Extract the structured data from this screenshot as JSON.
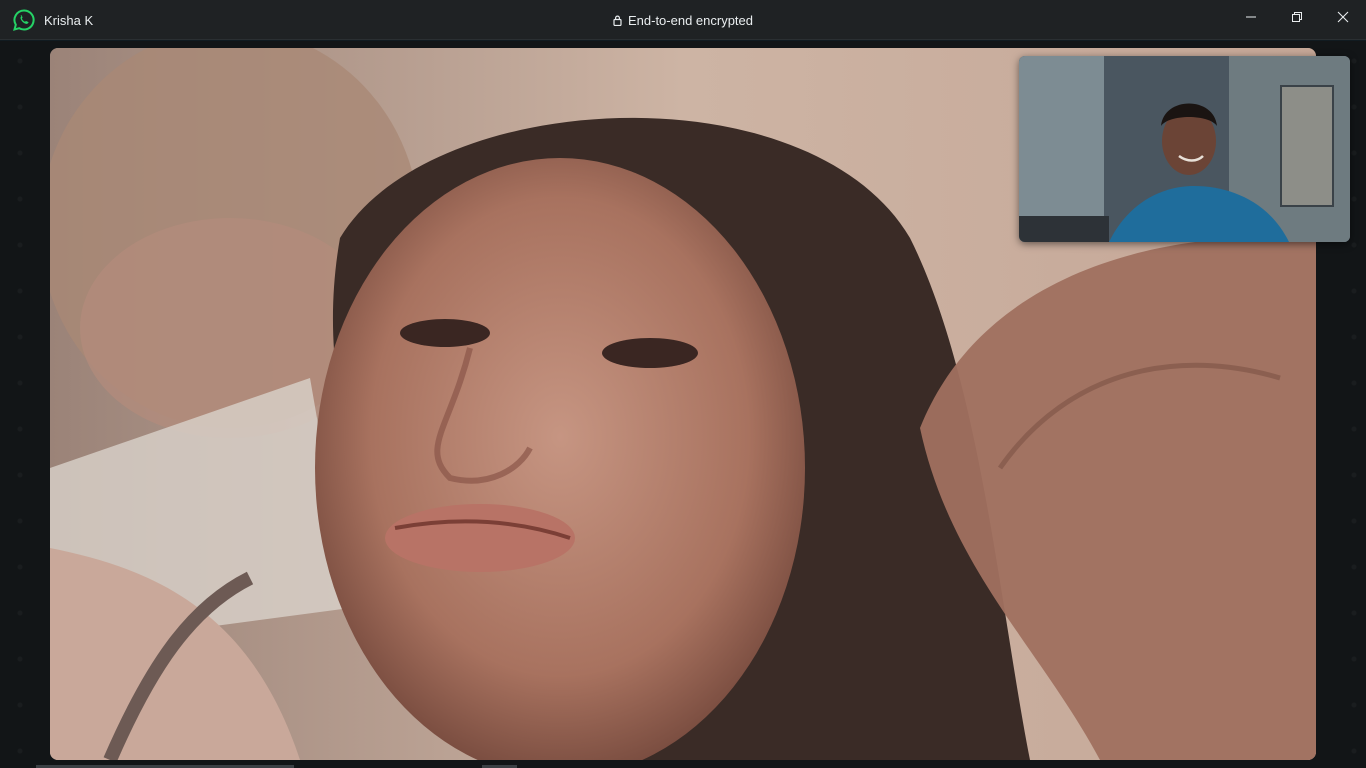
{
  "window": {
    "contact_name": "Krisha K",
    "encryption_status": "End-to-end encrypted",
    "app_icon": "whatsapp-icon",
    "controls": [
      "minimize-icon",
      "restore-icon",
      "close-icon"
    ]
  },
  "call": {
    "remote_video": "remote-participant-video",
    "self_video": "self-preview-video"
  },
  "colors": {
    "titlebar": "#1f2224",
    "accent_green": "#25d366",
    "background": "#121517"
  }
}
